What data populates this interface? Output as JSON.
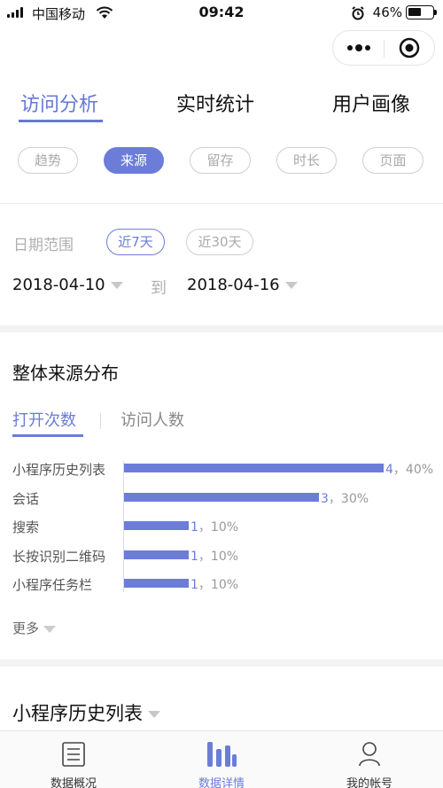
{
  "status_bar": {
    "carrier": "中国移动",
    "time": "09:42",
    "battery": "46%"
  },
  "top_tabs": [
    {
      "label": "访问分析",
      "active": true
    },
    {
      "label": "实时统计",
      "active": false
    },
    {
      "label": "用户画像",
      "active": false
    }
  ],
  "sub_tabs": [
    {
      "label": "趋势",
      "active": false
    },
    {
      "label": "来源",
      "active": true
    },
    {
      "label": "留存",
      "active": false
    },
    {
      "label": "时长",
      "active": false
    },
    {
      "label": "页面",
      "active": false
    }
  ],
  "date_filter": {
    "label": "日期范围",
    "options": [
      "近7天",
      "近30天"
    ],
    "selected": "近7天",
    "start": "2018-04-10",
    "to": "到",
    "end": "2018-04-16"
  },
  "source_section": {
    "title": "整体来源分布",
    "tabs": [
      "打开次数",
      "访问人数"
    ],
    "active_tab": "打开次数",
    "more": "更多"
  },
  "chart_data": {
    "type": "bar",
    "orientation": "horizontal",
    "categories": [
      "小程序历史列表",
      "会话",
      "搜索",
      "长按识别二维码",
      "小程序任务栏"
    ],
    "values": [
      4,
      3,
      1,
      1,
      1
    ],
    "percents": [
      "40%",
      "30%",
      "10%",
      "10%",
      "10%"
    ],
    "color": "#6b7dd9"
  },
  "detail_section": {
    "title": "小程序历史列表"
  },
  "tab_bar": {
    "items": [
      {
        "label": "数据概况",
        "active": false
      },
      {
        "label": "数据详情",
        "active": true
      },
      {
        "label": "我的帐号",
        "active": false
      }
    ]
  },
  "colors": {
    "accent": "#6b7dd9",
    "tab_active": "#6578d6"
  }
}
